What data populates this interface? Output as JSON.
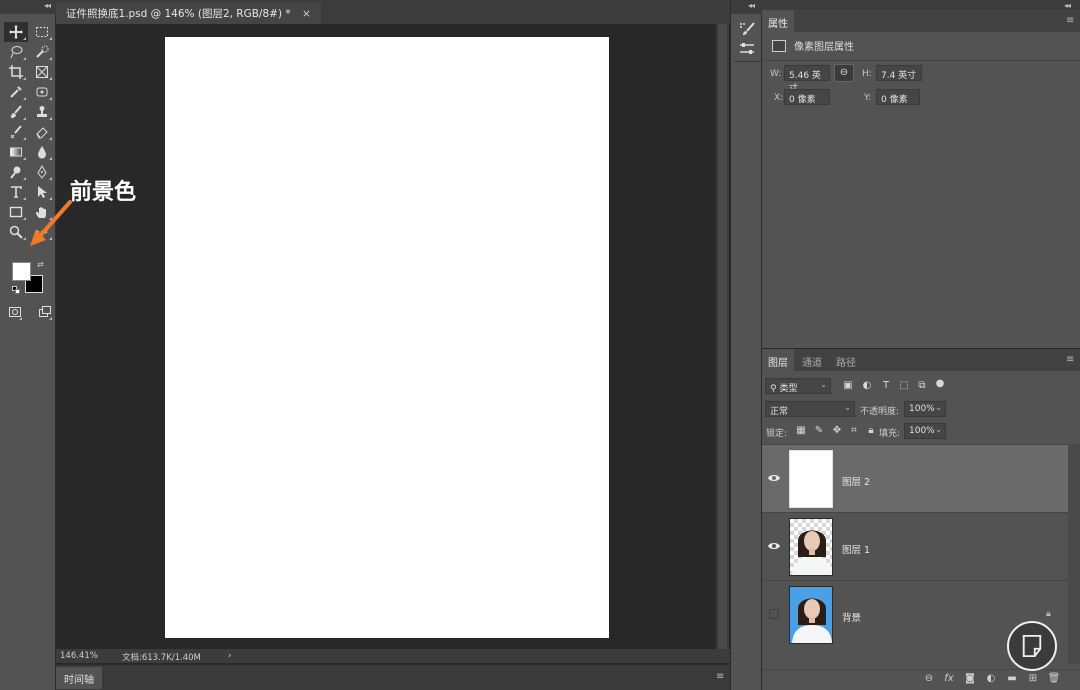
{
  "document_tab": {
    "title": "证件照换底1.psd @ 146% (图层2, RGB/8#) *",
    "close": "×"
  },
  "collapse_icons": {
    "left": "◂◂",
    "dock": "◂◂",
    "right": "◂◂"
  },
  "annotation": {
    "label": "前景色",
    "arrow_color": "#f07a2a"
  },
  "swatches": {
    "foreground": "#ffffff",
    "background": "#000000"
  },
  "status": {
    "zoom": "146.41%",
    "doc_size": "文档:613.7K/1.40M",
    "arrow": "›"
  },
  "timeline": {
    "tab": "时间轴",
    "menu": "≡"
  },
  "properties": {
    "tab": "属性",
    "menu": "≡",
    "title": "像素图层属性",
    "w_label": "W:",
    "w_value": "5.46 英寸",
    "h_label": "H:",
    "h_value": "7.4 英寸",
    "x_label": "X:",
    "x_value": "0 像素",
    "y_label": "Y:",
    "y_value": "0 像素",
    "link_icon": "⊖"
  },
  "layers_panel": {
    "tabs": [
      "图层",
      "通道",
      "路径"
    ],
    "menu": "≡",
    "filter_kind": "类型",
    "blend_mode": "正常",
    "opacity_label": "不透明度:",
    "opacity_value": "100%",
    "lock_label": "锁定:",
    "fill_label": "填充:",
    "fill_value": "100%",
    "layers": [
      {
        "name": "图层 2",
        "visible": true,
        "selected": true
      },
      {
        "name": "图层 1",
        "visible": true,
        "selected": false
      },
      {
        "name": "背景",
        "visible": false,
        "selected": false,
        "locked": true
      }
    ]
  },
  "colors": {
    "accent_arrow": "#f07a2a",
    "photo_blue": "#4a9fe6",
    "canvas": "#ffffff"
  }
}
